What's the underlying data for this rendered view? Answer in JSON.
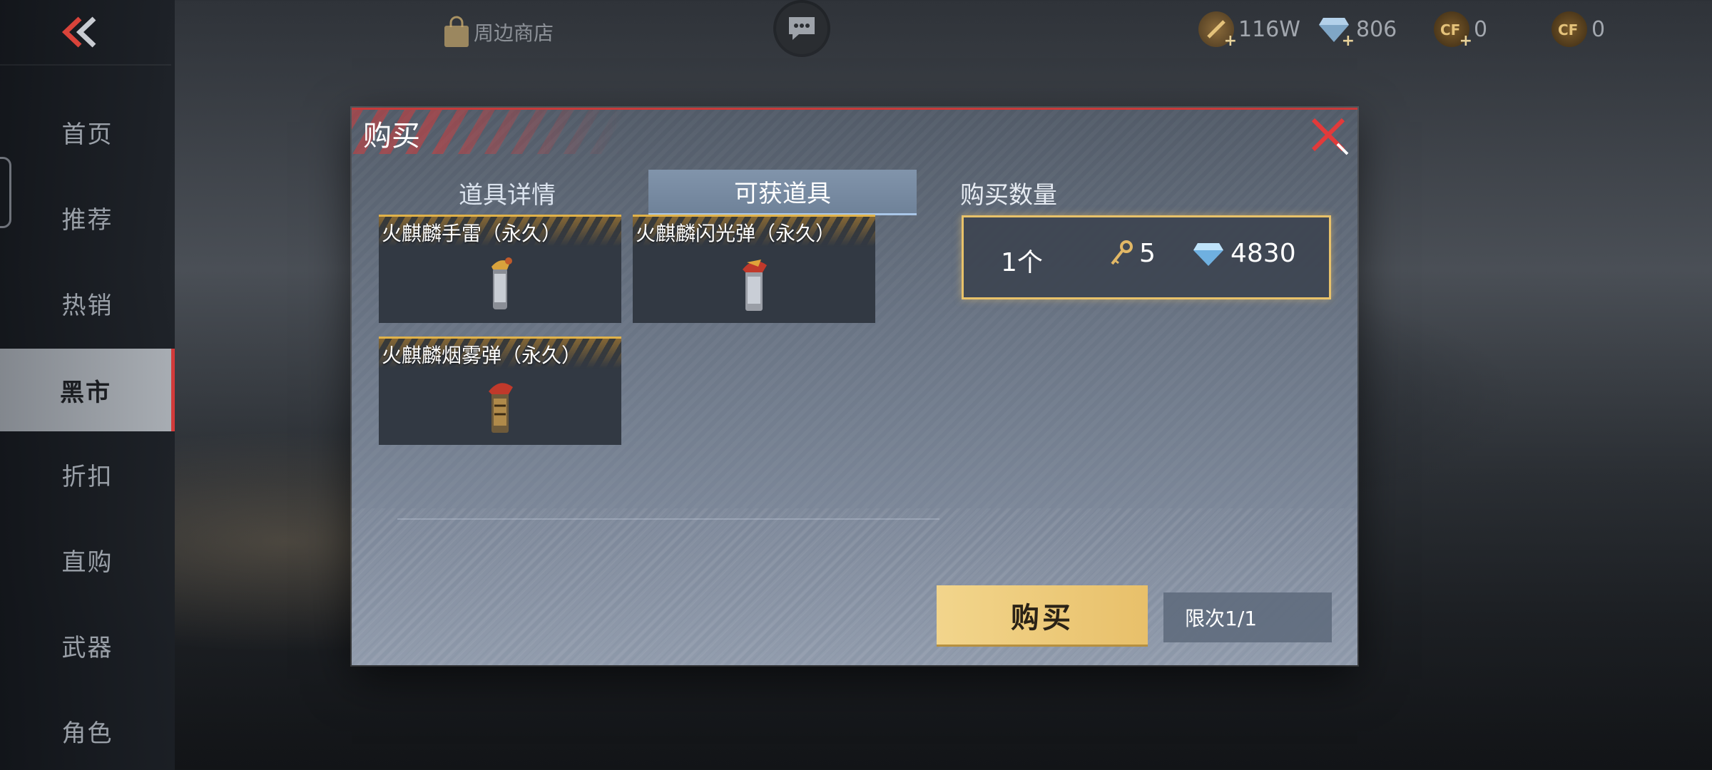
{
  "topbar": {
    "shop_label": "周边商店",
    "currencies": [
      {
        "icon": "gold-coin-icon",
        "value": "116W"
      },
      {
        "icon": "diamond-icon",
        "value": "806"
      },
      {
        "icon": "cf-point-icon",
        "value": "0"
      },
      {
        "icon": "cf-token-icon",
        "value": "0"
      }
    ]
  },
  "sidebar": {
    "items": [
      {
        "label": "首页",
        "active": false
      },
      {
        "label": "推荐",
        "active": false
      },
      {
        "label": "热销",
        "active": false
      },
      {
        "label": "黑市",
        "active": true
      },
      {
        "label": "折扣",
        "active": false
      },
      {
        "label": "直购",
        "active": false
      },
      {
        "label": "武器",
        "active": false
      },
      {
        "label": "角色",
        "active": false
      }
    ]
  },
  "modal": {
    "title": "购买",
    "tabs": [
      {
        "label": "道具详情",
        "active": false
      },
      {
        "label": "可获道具",
        "active": true
      }
    ],
    "items": [
      {
        "name": "火麒麟手雷（永久）"
      },
      {
        "name": "火麒麟闪光弹（永久）"
      },
      {
        "name": "火麒麟烟雾弹（永久）"
      }
    ],
    "quantity": {
      "label": "购买数量",
      "count": "1个",
      "key_cost": "5",
      "gem_cost": "4830"
    },
    "buy_label": "购买",
    "limit_label": "限次1/1"
  },
  "colors": {
    "accent_red": "#c83a3a",
    "gold": "#e8c26a",
    "sidebar_active": "#aeb3ba"
  }
}
